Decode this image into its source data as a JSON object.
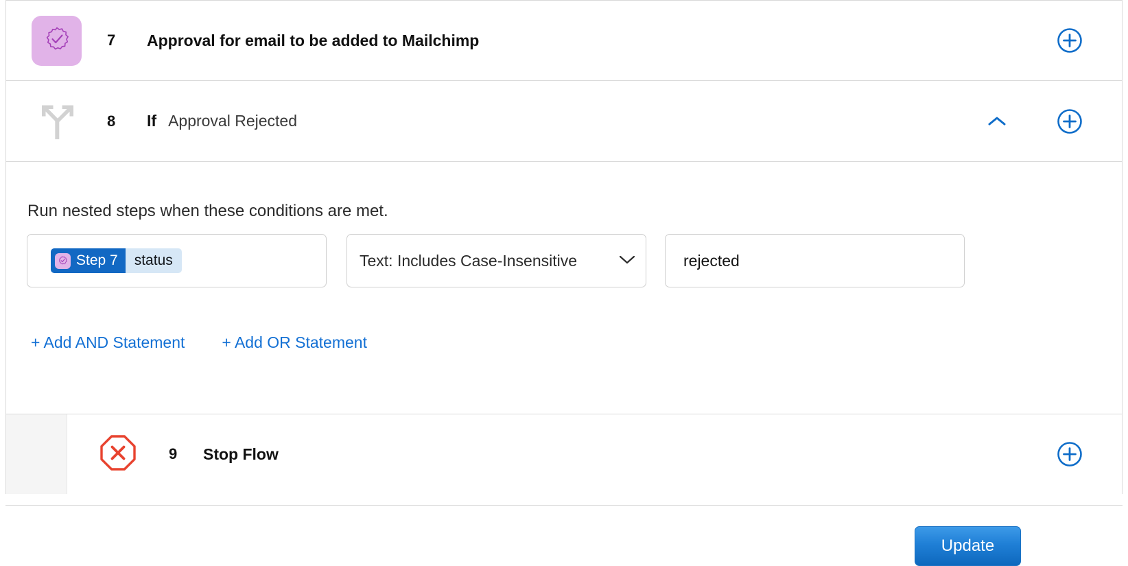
{
  "colors": {
    "accent_blue": "#1370d4",
    "token_blue": "#1268c3",
    "token_blue_light": "#d6e7f6",
    "approval_purple": "#e1b3e8",
    "approval_purple_stroke": "#a43fb8",
    "stop_red": "#e8432f",
    "branch_gray": "#d2d2d2",
    "border_gray": "#d9d9d9",
    "nested_gutter": "#f5f5f5"
  },
  "steps": [
    {
      "number": "7",
      "title": "Approval for email to be added to Mailchimp",
      "icon": "approval-seal-icon",
      "add_icon": "plus-circle-icon"
    },
    {
      "number": "8",
      "keyword": "If",
      "title": "Approval Rejected",
      "icon": "branch-fork-icon",
      "collapse_icon": "chevron-up-icon",
      "add_icon": "plus-circle-icon"
    },
    {
      "number": "9",
      "title": "Stop Flow",
      "icon": "stop-octagon-icon",
      "add_icon": "plus-circle-icon"
    }
  ],
  "condition_panel": {
    "description": "Run nested steps when these conditions are met.",
    "condition": {
      "source_token": {
        "step_label": "Step 7",
        "field_label": "status",
        "icon": "approval-seal-icon"
      },
      "operator": {
        "selected": "Text: Includes Case-Insensitive",
        "chevron_icon": "chevron-down-icon"
      },
      "value": "rejected"
    },
    "add_and_label": "+ Add AND Statement",
    "add_or_label": "+ Add OR Statement",
    "update_label": "Update"
  }
}
